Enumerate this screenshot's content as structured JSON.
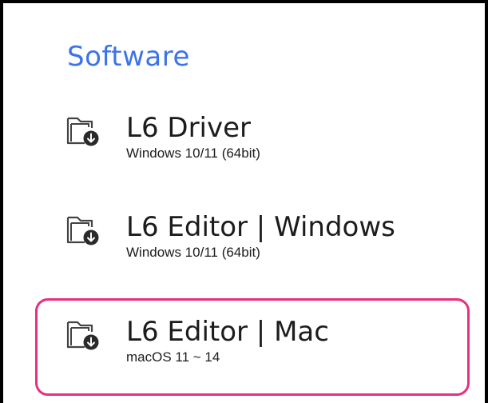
{
  "section": {
    "title": "Software"
  },
  "items": [
    {
      "name": "L6 Driver",
      "requirement": "Windows 10/11 (64bit)",
      "icon": "folder-download-icon"
    },
    {
      "name": "L6 Editor | Windows",
      "requirement": "Windows 10/11 (64bit)",
      "icon": "folder-download-icon"
    },
    {
      "name": "L6 Editor | Mac",
      "requirement": "macOS 11 ~ 14",
      "icon": "folder-download-icon",
      "highlighted": true
    }
  ],
  "colors": {
    "title": "#3b74e8",
    "text": "#1c1c1c",
    "highlight": "#e6307e",
    "frame": "#000000"
  }
}
